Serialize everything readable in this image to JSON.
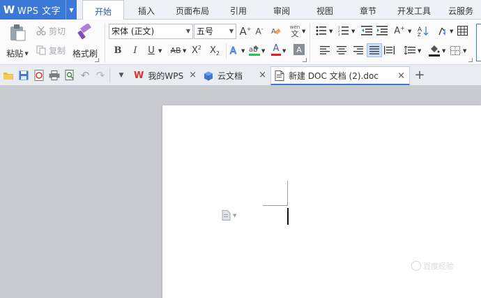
{
  "app": {
    "title": "WPS 文字",
    "logo_letter": "W"
  },
  "menu_tabs": [
    {
      "label": "开始",
      "active": true
    },
    {
      "label": "插入"
    },
    {
      "label": "页面布局"
    },
    {
      "label": "引用"
    },
    {
      "label": "审阅"
    },
    {
      "label": "视图"
    },
    {
      "label": "章节"
    },
    {
      "label": "开发工具"
    },
    {
      "label": "云服务"
    }
  ],
  "ribbon": {
    "paste_label": "粘贴",
    "cut_label": "剪切",
    "copy_label": "复制",
    "format_painter_label": "格式刷",
    "font_name": "宋体 (正文)",
    "font_size": "五号",
    "bold": "B",
    "italic": "I",
    "underline": "U",
    "strike": "AB",
    "superscript_base": "X",
    "superscript": "2",
    "subscript_base": "X",
    "subscript": "2",
    "font_color_letter": "A",
    "char_shading_letter": "A",
    "grow_letter": "A",
    "shrink_letter": "A",
    "phonetic_top": "wén",
    "phonetic_bottom": "文",
    "colors": {
      "highlight": "#22c55e",
      "font_color": "#e11d2a",
      "accent": "#3b78d8"
    }
  },
  "doc_tabs": [
    {
      "label": "我的WPS",
      "icon": "wps-logo-icon"
    },
    {
      "label": "云文档",
      "icon": "cloud-cube-icon"
    },
    {
      "label": "新建 DOC 文档 (2).doc",
      "icon": "document-icon",
      "active": true
    }
  ],
  "watermark": {
    "text": "百度经验"
  }
}
